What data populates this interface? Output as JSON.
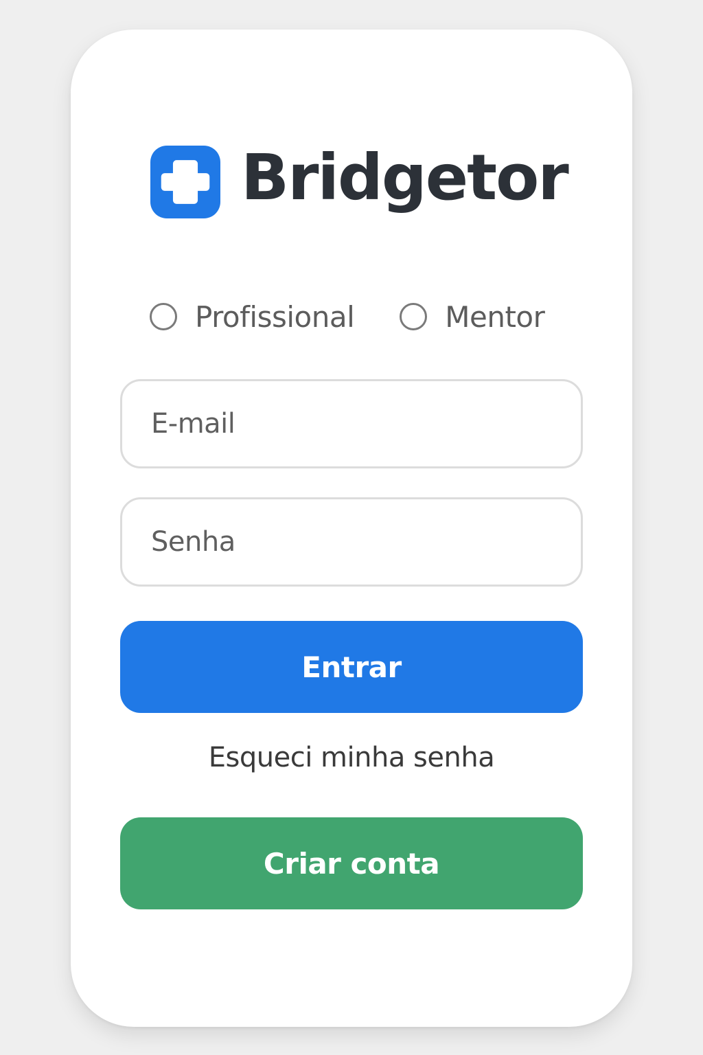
{
  "brand": {
    "name": "Bridgetor",
    "icon": "medical-cross-icon",
    "icon_color": "#2079e6",
    "text_color": "#2c3138"
  },
  "roles": {
    "options": [
      {
        "label": "Profissional",
        "selected": false
      },
      {
        "label": "Mentor",
        "selected": false
      }
    ]
  },
  "form": {
    "email_placeholder": "E-mail",
    "email_value": "",
    "password_placeholder": "Senha",
    "password_value": ""
  },
  "actions": {
    "login_label": "Entrar",
    "login_color": "#2079e6",
    "forgot_label": "Esqueci minha senha",
    "create_label": "Criar conta",
    "create_color": "#41a56f"
  }
}
